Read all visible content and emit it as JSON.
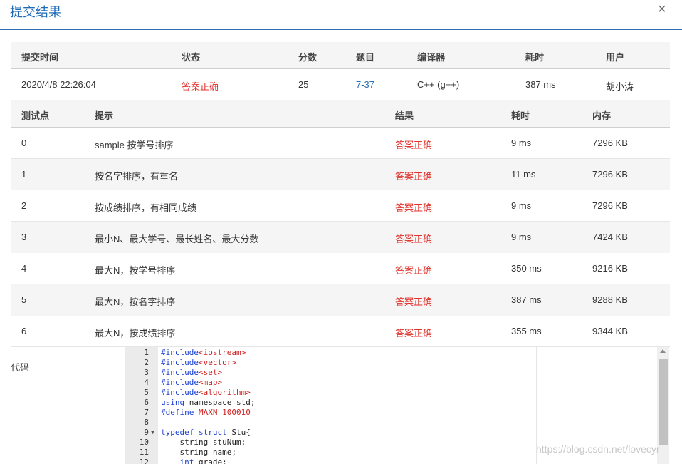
{
  "dialog": {
    "title": "提交结果",
    "close_glyph": "×"
  },
  "summary": {
    "headers": [
      "提交时间",
      "状态",
      "分数",
      "题目",
      "编译器",
      "耗时",
      "用户"
    ],
    "row": {
      "time": "2020/4/8 22:26:04",
      "status": "答案正确",
      "score": "25",
      "problem": "7-37",
      "compiler": "C++ (g++)",
      "elapsed": "387 ms",
      "user": "胡小涛"
    }
  },
  "cases": {
    "headers": [
      "测试点",
      "提示",
      "结果",
      "耗时",
      "内存"
    ],
    "rows": [
      {
        "id": "0",
        "hint": "sample 按学号排序",
        "result": "答案正确",
        "time": "9 ms",
        "memory": "7296 KB"
      },
      {
        "id": "1",
        "hint": "按名字排序，有重名",
        "result": "答案正确",
        "time": "11 ms",
        "memory": "7296 KB"
      },
      {
        "id": "2",
        "hint": "按成绩排序，有相同成绩",
        "result": "答案正确",
        "time": "9 ms",
        "memory": "7296 KB"
      },
      {
        "id": "3",
        "hint": "最小N、最大学号、最长姓名、最大分数",
        "result": "答案正确",
        "time": "9 ms",
        "memory": "7424 KB"
      },
      {
        "id": "4",
        "hint": "最大N，按学号排序",
        "result": "答案正确",
        "time": "350 ms",
        "memory": "9216 KB"
      },
      {
        "id": "5",
        "hint": "最大N，按名字排序",
        "result": "答案正确",
        "time": "387 ms",
        "memory": "9288 KB"
      },
      {
        "id": "6",
        "hint": "最大N，按成绩排序",
        "result": "答案正确",
        "time": "355 ms",
        "memory": "9344 KB"
      }
    ]
  },
  "code": {
    "label": "代码",
    "lines": [
      {
        "n": "1",
        "parts": [
          [
            "pp",
            "#include"
          ],
          [
            "str",
            "<iostream>"
          ]
        ]
      },
      {
        "n": "2",
        "parts": [
          [
            "pp",
            "#include"
          ],
          [
            "str",
            "<vector>"
          ]
        ]
      },
      {
        "n": "3",
        "parts": [
          [
            "pp",
            "#include"
          ],
          [
            "str",
            "<set>"
          ]
        ]
      },
      {
        "n": "4",
        "parts": [
          [
            "pp",
            "#include"
          ],
          [
            "str",
            "<map>"
          ]
        ]
      },
      {
        "n": "5",
        "parts": [
          [
            "pp",
            "#include"
          ],
          [
            "str",
            "<algorithm>"
          ]
        ]
      },
      {
        "n": "6",
        "parts": [
          [
            "kw",
            "using"
          ],
          [
            "plain",
            " namespace std;"
          ]
        ]
      },
      {
        "n": "7",
        "parts": [
          [
            "pp",
            "#define"
          ],
          [
            "str",
            " MAXN 100010"
          ]
        ]
      },
      {
        "n": "8",
        "parts": []
      },
      {
        "n": "9",
        "fold": true,
        "parts": [
          [
            "kw",
            "typedef"
          ],
          [
            "plain",
            " "
          ],
          [
            "kw",
            "struct"
          ],
          [
            "plain",
            " Stu{"
          ]
        ]
      },
      {
        "n": "10",
        "parts": [
          [
            "plain",
            "    string stuNum;"
          ]
        ]
      },
      {
        "n": "11",
        "parts": [
          [
            "plain",
            "    string name;"
          ]
        ]
      },
      {
        "n": "12",
        "parts": [
          [
            "plain",
            "    "
          ],
          [
            "kw",
            "int"
          ],
          [
            "plain",
            " grade;"
          ]
        ]
      }
    ]
  },
  "watermark": "https://blog.csdn.net/lovecyr"
}
